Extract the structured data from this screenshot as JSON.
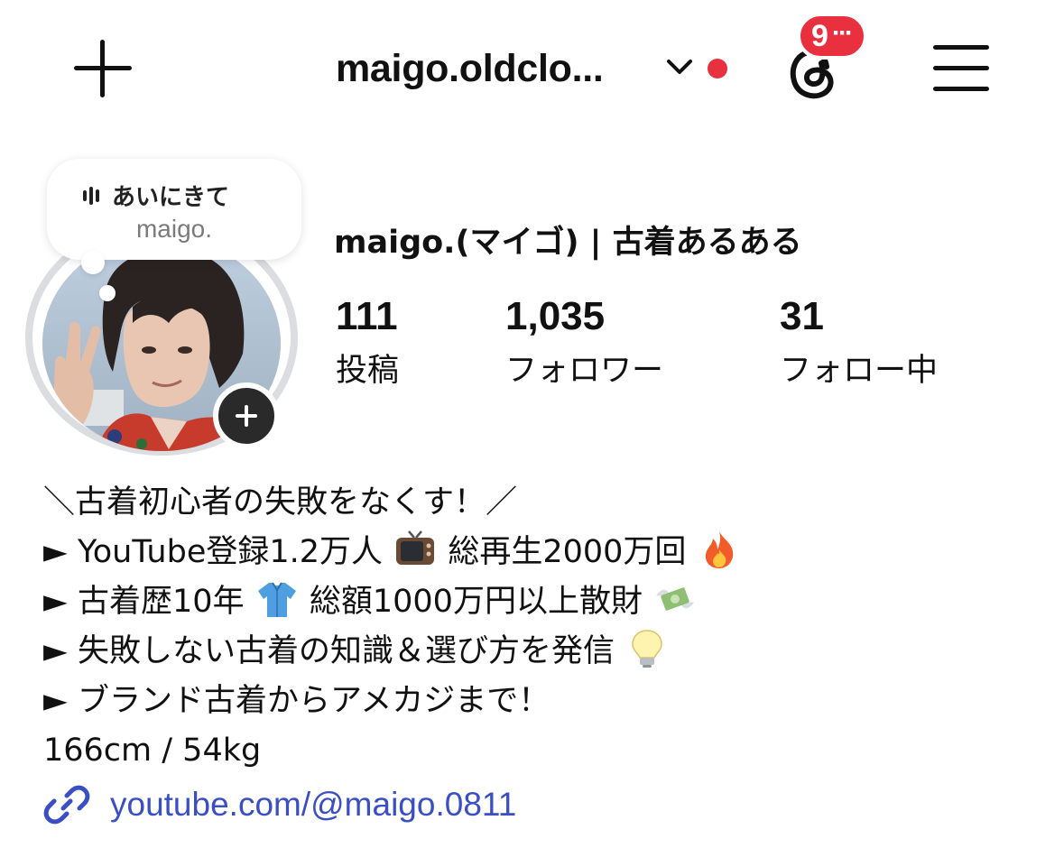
{
  "header": {
    "username": "maigo.oldclo...",
    "notification_count": "9",
    "notification_more": "···",
    "icons": [
      "plus-icon",
      "chevron-down-icon",
      "threads-icon",
      "menu-icon"
    ],
    "live_dot_color": "#e8303f"
  },
  "note": {
    "text": "あいにきて",
    "author": "maigo."
  },
  "profile": {
    "display_name": "maigo.(マイゴ) | 古着あるある",
    "stats": [
      {
        "value": "111",
        "label": "投稿"
      },
      {
        "value": "1,035",
        "label": "フォロワー"
      },
      {
        "value": "31",
        "label": "フォロー中"
      }
    ]
  },
  "bio": {
    "line1": "＼古着初心者の失敗をなくす！／",
    "line2_a": "► YouTube登録1.2万人",
    "line2_b": "総再生2000万回",
    "line3_a": "► 古着歴10年",
    "line3_b": "総額1000万円以上散財",
    "line4": "► 失敗しない古着の知識＆選び方を発信",
    "line5": "► ブランド古着からアメカジまで！",
    "line6": "166cm / 54kg",
    "emoji": [
      "tv-emoji",
      "fire-emoji",
      "shirt-emoji",
      "money-wings-emoji",
      "lightbulb-emoji"
    ],
    "link": "youtube.com/@maigo.0811",
    "link_color": "#3a4fc4"
  }
}
